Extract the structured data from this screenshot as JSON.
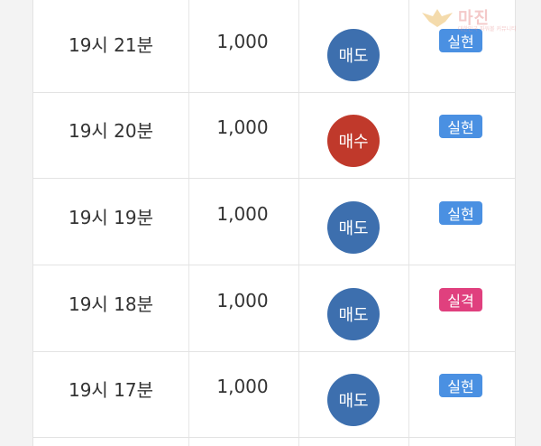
{
  "colors": {
    "sell": "#3d6fae",
    "buy": "#c0392b",
    "hit": "#4a90e2",
    "miss": "#e0407e"
  },
  "watermark": {
    "title": "마진",
    "subtitle": "대한민국 파워볼 커뮤니티"
  },
  "rows": [
    {
      "time": "19시 21분",
      "amount": "1,000",
      "trade": "매도",
      "trade_type": "sell",
      "result": "실현",
      "result_type": "hit"
    },
    {
      "time": "19시 20분",
      "amount": "1,000",
      "trade": "매수",
      "trade_type": "buy",
      "result": "실현",
      "result_type": "hit"
    },
    {
      "time": "19시 19분",
      "amount": "1,000",
      "trade": "매도",
      "trade_type": "sell",
      "result": "실현",
      "result_type": "hit"
    },
    {
      "time": "19시 18분",
      "amount": "1,000",
      "trade": "매도",
      "trade_type": "sell",
      "result": "실격",
      "result_type": "miss"
    },
    {
      "time": "19시 17분",
      "amount": "1,000",
      "trade": "매도",
      "trade_type": "sell",
      "result": "실현",
      "result_type": "hit"
    }
  ]
}
